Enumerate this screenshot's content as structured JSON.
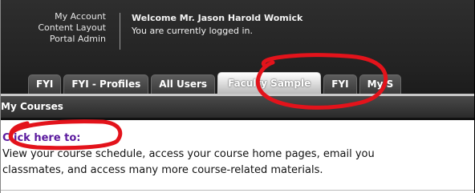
{
  "account_links": [
    "My Account",
    "Content Layout",
    "Portal Admin"
  ],
  "welcome": {
    "name_line": "Welcome Mr. Jason Harold Womick",
    "status_line": "You are currently logged in."
  },
  "tabs": [
    {
      "label": "FYI",
      "active": false
    },
    {
      "label": "FYI - Profiles",
      "active": false
    },
    {
      "label": "All Users",
      "active": false
    },
    {
      "label": "Faculty Sample",
      "active": true
    },
    {
      "label": "FYI",
      "active": false
    },
    {
      "label": "My S",
      "active": false
    }
  ],
  "module": {
    "title": "My Courses",
    "link_text": "Click here to:",
    "description_line1": "View your course schedule, access your course home pages, email you",
    "description_line2": "classmates, and access many more course-related materials."
  },
  "colors": {
    "annotation": "#e3131b",
    "link": "#5b1a9e",
    "header_bg": "#262626"
  }
}
